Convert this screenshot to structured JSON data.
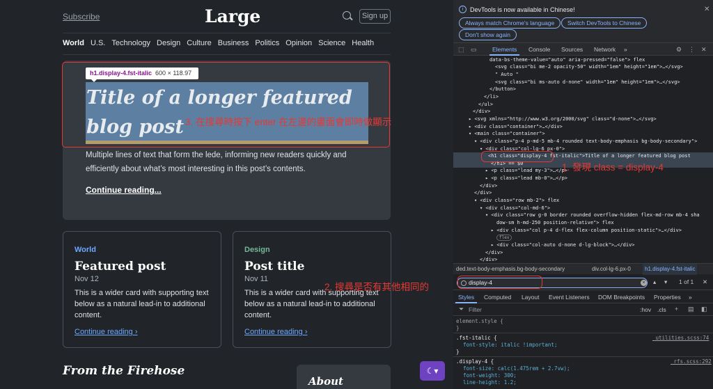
{
  "site": {
    "subscribe": "Subscribe",
    "brand": "Large",
    "signup": "Sign up",
    "nav": [
      "World",
      "U.S.",
      "Technology",
      "Design",
      "Culture",
      "Business",
      "Politics",
      "Opinion",
      "Science",
      "Health"
    ],
    "tooltip_selector": "h1.display-4.fst-italic",
    "tooltip_size": "600 × 118.97",
    "hero_title_line1": "Title of a longer featured",
    "hero_title_line2": "blog post",
    "hero_lede": "Multiple lines of text that form the lede, informing new readers quickly and efficiently about what’s most interesting in this post’s contents.",
    "continue_reading": "Continue reading...",
    "cards": [
      {
        "category": "World",
        "category_color": "#6ea8fe",
        "title": "Featured post",
        "date": "Nov 12",
        "text": "This is a wider card with supporting text below as a natural lead-in to additional content.",
        "link": "Continue reading ›"
      },
      {
        "category": "Design",
        "category_color": "#75b798",
        "title": "Post title",
        "date": "Nov 11",
        "text": "This is a wider card with supporting text below as a natural lead-in to additional content.",
        "link": "Continue reading ›"
      }
    ],
    "firehose": "From the Firehose",
    "about": "About",
    "theme_icon": "moon-icon"
  },
  "annotations": {
    "a1": "1. 發現 class = display-4",
    "a2": "2. 搜尋是否有其他相同的",
    "a3": "3. 在搜尋時按下 enter 在左邊的畫面會即時做顯示"
  },
  "devtools": {
    "notice": "DevTools is now available in Chinese!",
    "btn_match": "Always match Chrome's language",
    "btn_switch": "Switch DevTools to Chinese",
    "btn_dont": "Don't show again",
    "tabs": [
      "Elements",
      "Console",
      "Sources",
      "Network"
    ],
    "more_tabs": "»",
    "tree": [
      "data-bs-theme-value=\"auto\" aria-pressed=\"false\"> flex",
      "<svg class=\"bi me-2 opacity-50\" width=\"1em\" height=\"1em\">…</svg>",
      "\" Auto \"",
      "<svg class=\"bi ms-auto d-none\" width=\"1em\" height=\"1em\">…</svg>",
      "</button>",
      "</li>",
      "</ul>",
      "</div>",
      "▸ <svg xmlns=\"http://www.w3.org/2000/svg\" class=\"d-none\">…</svg>",
      "▸ <div class=\"container\">…</div>",
      "▾ <main class=\"container\">",
      "▾ <div class=\"p-4 p-md-5 mb-4 rounded text-body-emphasis bg-body-secondary\">",
      "▾ <div class=\"col-lg-6 px-0\">",
      "<h1 class=\"display-4 fst-italic\">Title of a longer featured blog post",
      "</h1> == $0",
      "▸ <p class=\"lead my-3\">…</p>",
      "▸ <p class=\"lead mb-0\">…</p>",
      "</div>",
      "</div>",
      "▾ <div class=\"row mb-2\"> flex",
      "▾ <div class=\"col-md-6\">",
      "▾ <div class=\"row g-0 border rounded overflow-hidden flex-md-row mb-4 sha",
      "dow-sm h-md-250 position-relative\"> flex",
      "▸ <div class=\"col p-4 d-flex flex-column position-static\">…</div>",
      "flex",
      "▸ <div class=\"col-auto d-none d-lg-block\">…</div>",
      "</div>",
      "</div>"
    ],
    "crumbs": [
      "ded.text-body-emphasis.bg-body-secondary",
      "div.col-lg-6.px-0",
      "h1.display-4.fst-italic"
    ],
    "search_value": "display-4",
    "search_count": "1 of 1",
    "style_tabs": [
      "Styles",
      "Computed",
      "Layout",
      "Event Listeners",
      "DOM Breakpoints",
      "Properties",
      "»"
    ],
    "filter_placeholder": "Filter",
    "filter_hov": ":hov",
    "filter_cls": ".cls",
    "rules": [
      {
        "sel": "element.style {",
        "lines": [
          "}"
        ],
        "file": ""
      },
      {
        "sel": ".fst-italic {",
        "lines": [
          "font-style: italic !important;",
          "}"
        ],
        "file": "_utilities.scss:74"
      },
      {
        "sel": ".display-4 {",
        "lines": [
          "font-size: calc(1.475rem + 2.7vw);",
          "font-weight: 300;",
          "line-height: 1.2;"
        ],
        "file": "_rfs.scss:292"
      }
    ]
  }
}
